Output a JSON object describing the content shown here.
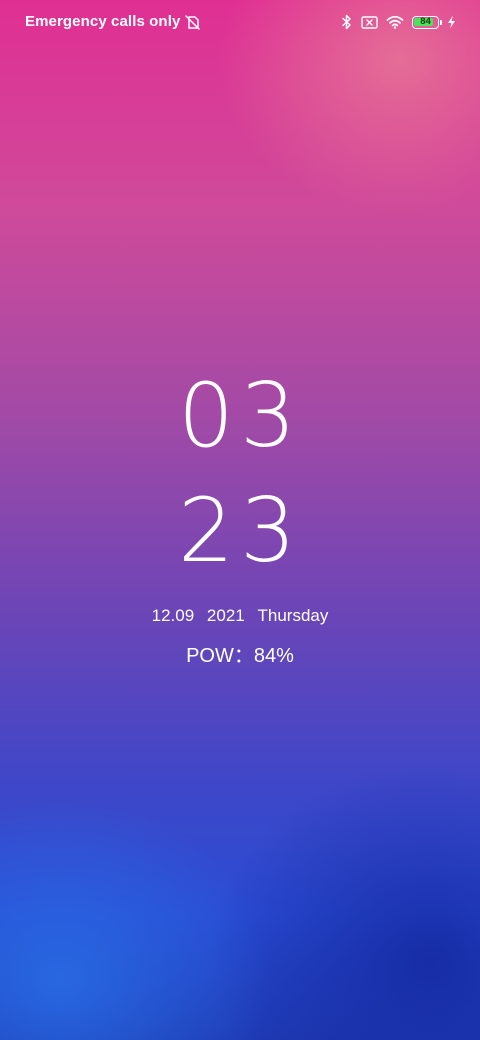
{
  "status_bar": {
    "carrier": "Emergency calls only",
    "icons": [
      "no-sim-icon",
      "bluetooth-icon",
      "sim-x-icon",
      "wifi-icon",
      "battery-icon",
      "charging-bolt-icon"
    ],
    "battery_level": "84",
    "battery_percent": 84,
    "battery_color": "#4fe05c"
  },
  "clock": {
    "hours": "03",
    "minutes": "23"
  },
  "date": {
    "day_month": "12.09",
    "year": "2021",
    "weekday": "Thursday"
  },
  "power": {
    "label": "POW：84%"
  },
  "colors": {
    "top": "#e02f93",
    "middle": "#6e45b6",
    "bottom": "#1f3bb5"
  }
}
